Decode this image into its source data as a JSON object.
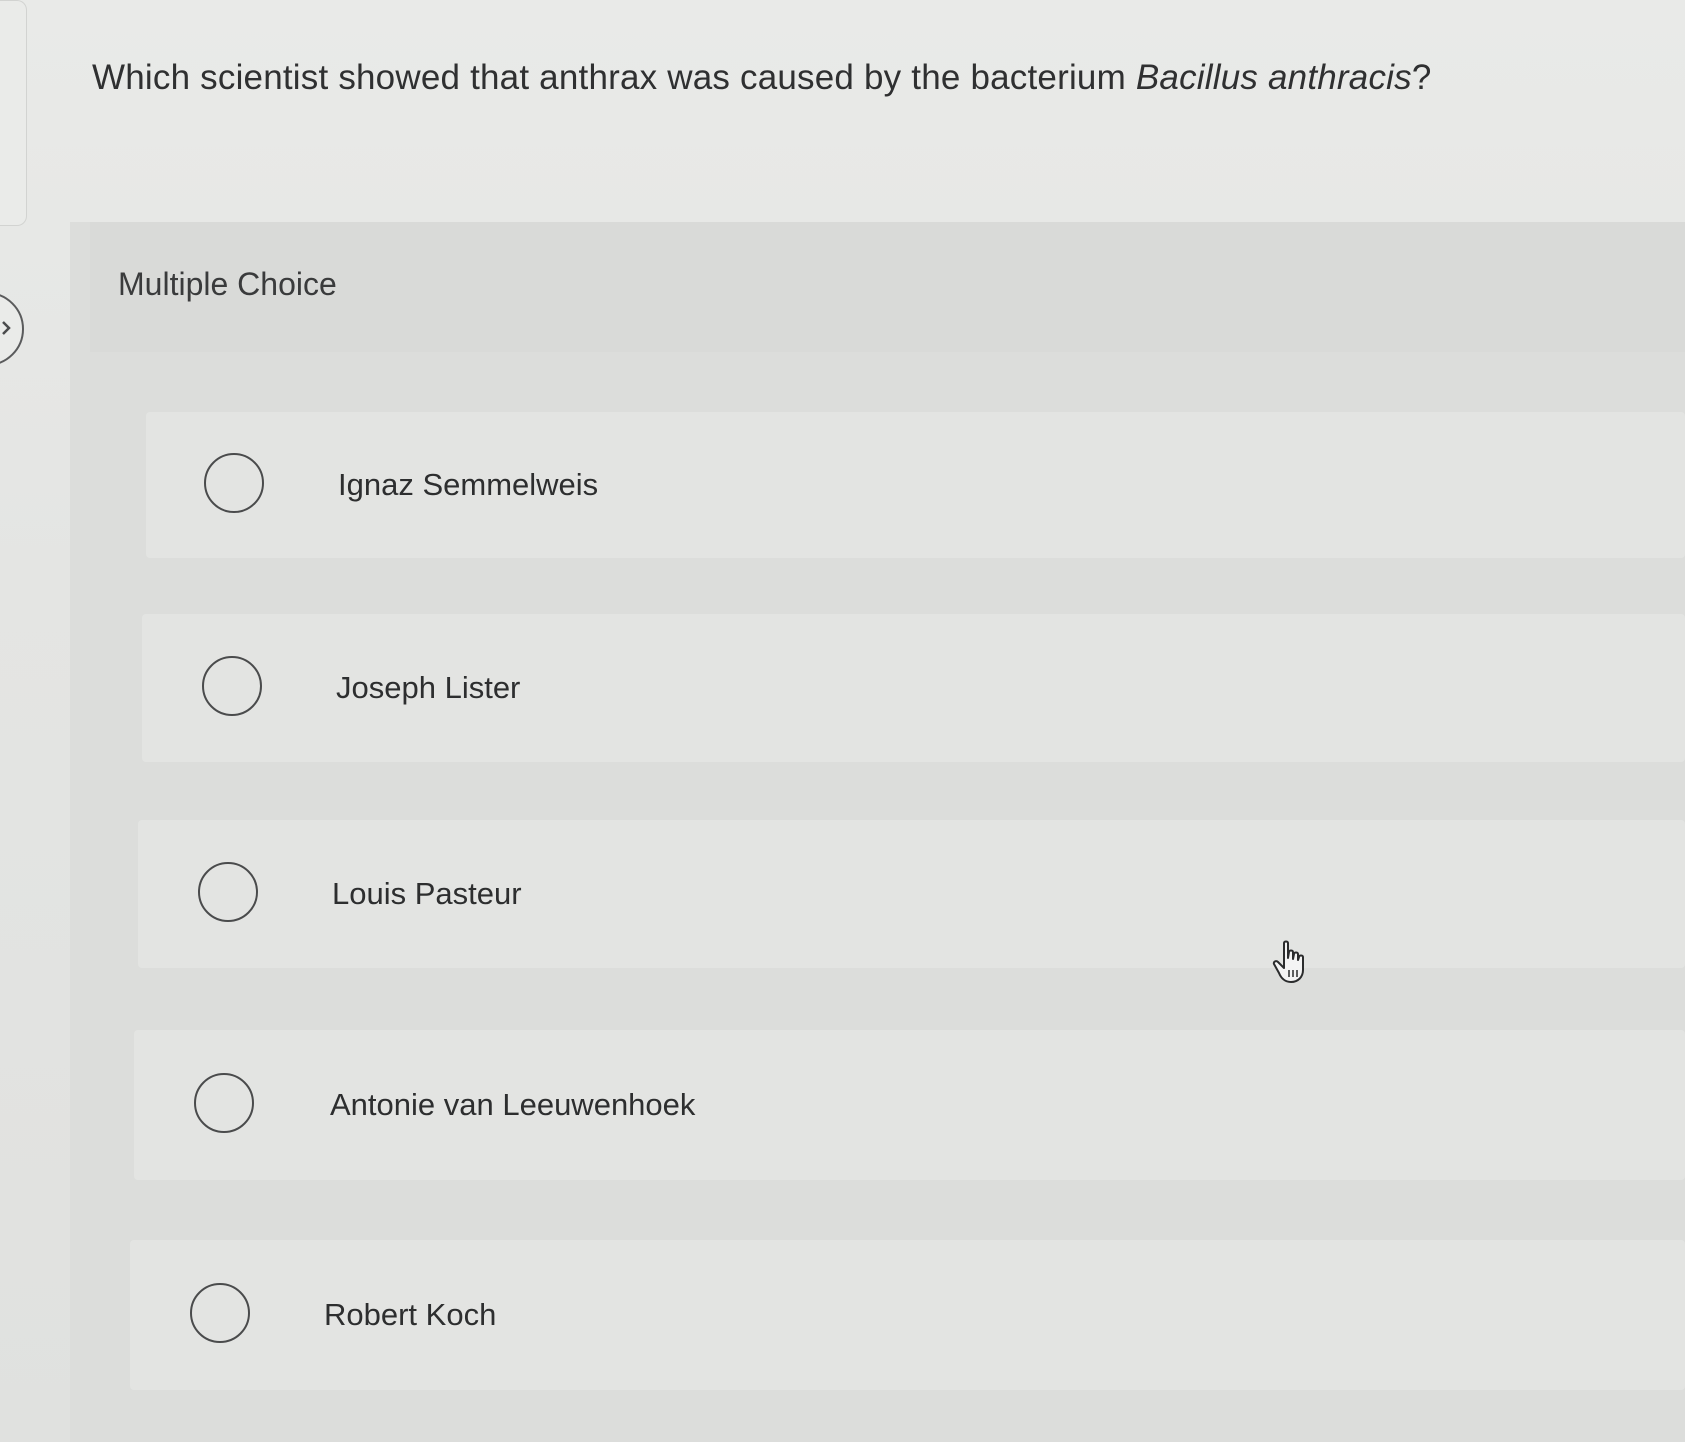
{
  "question": {
    "prefix": "Which scientist showed that anthrax was caused by the bacterium ",
    "organism": "Bacillus anthracis",
    "suffix": "?"
  },
  "section_label": "Multiple Choice",
  "options": [
    {
      "label": "Ignaz Semmelweis",
      "selected": false
    },
    {
      "label": "Joseph Lister",
      "selected": false
    },
    {
      "label": "Louis Pasteur",
      "selected": false
    },
    {
      "label": "Antonie van Leeuwenhoek",
      "selected": false
    },
    {
      "label": "Robert Koch",
      "selected": false
    }
  ],
  "icons": {
    "radio": "radio-unselected-icon",
    "cursor": "hand-pointer-icon",
    "nav": "chevron-right-icon"
  },
  "colors": {
    "text": "#2f3031",
    "radio_border": "#4a4b4c",
    "background": "#e6e7e5"
  }
}
